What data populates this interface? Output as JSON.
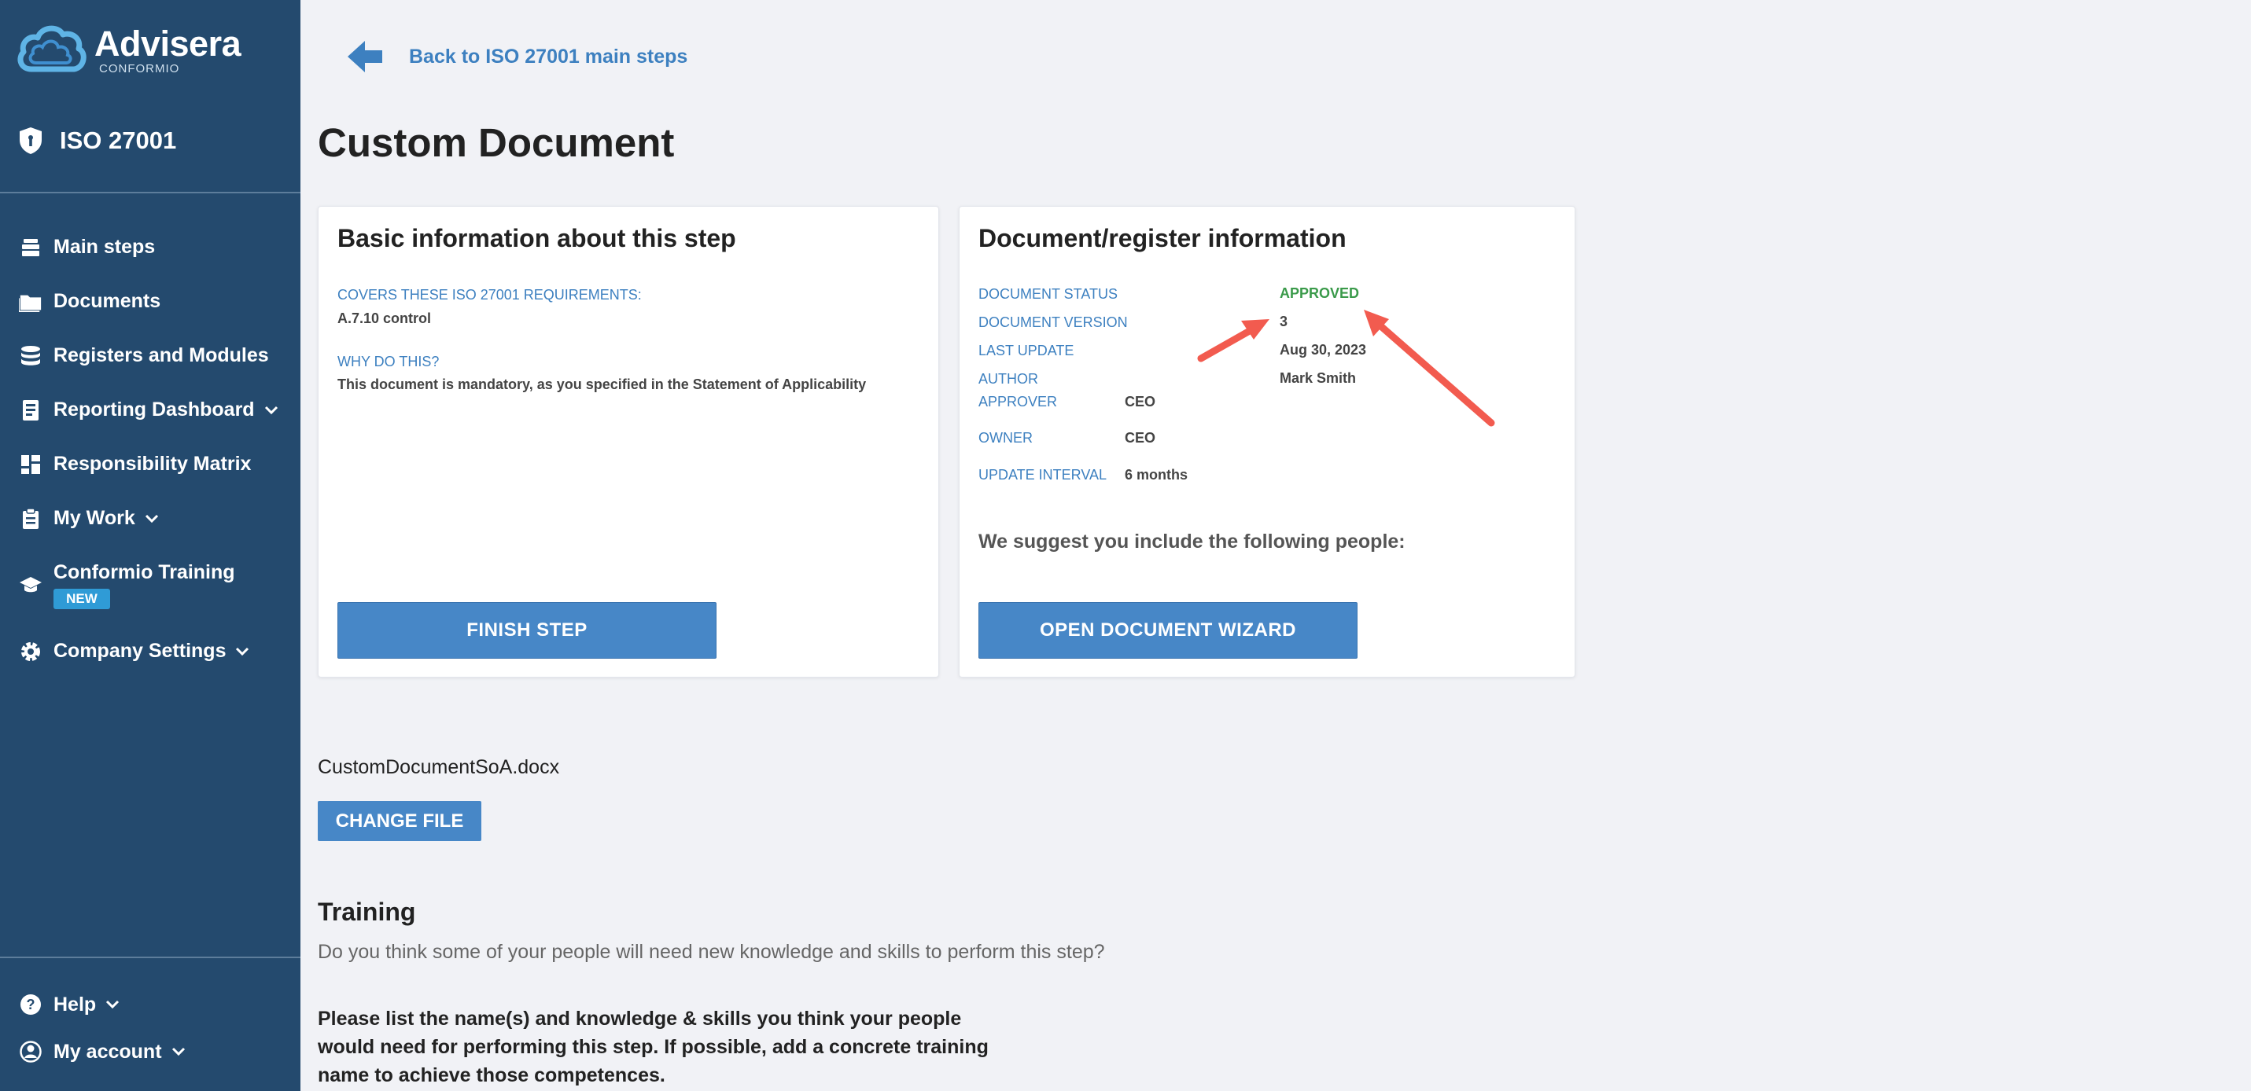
{
  "sidebar": {
    "logo": {
      "brand": "Advisera",
      "sub": "CONFORMIO"
    },
    "product": "ISO 27001",
    "items": [
      {
        "label": "Main steps",
        "icon": "layers-icon"
      },
      {
        "label": "Documents",
        "icon": "folder-icon"
      },
      {
        "label": "Registers and Modules",
        "icon": "database-icon"
      },
      {
        "label": "Reporting Dashboard",
        "icon": "report-icon"
      },
      {
        "label": "Responsibility Matrix",
        "icon": "grid-icon"
      },
      {
        "label": "My Work",
        "icon": "clipboard-icon"
      },
      {
        "label": "Conformio Training",
        "icon": "graduation-cap-icon",
        "badge": "NEW"
      },
      {
        "label": "Company Settings",
        "icon": "gear-icon"
      }
    ],
    "bottom": [
      {
        "label": "Help",
        "icon": "help-icon"
      },
      {
        "label": "My account",
        "icon": "account-icon"
      }
    ]
  },
  "main": {
    "back_link": "Back to ISO 27001 main steps",
    "title": "Custom Document",
    "basic_card": {
      "title": "Basic information about this step",
      "covers_label": "COVERS THESE ISO 27001 REQUIREMENTS:",
      "covers_value": "A.7.10 control",
      "why_label": "WHY DO THIS?",
      "why_value": "This document is mandatory, as you specified in the Statement of Applicability",
      "button": "FINISH STEP"
    },
    "doc_card": {
      "title": "Document/register information",
      "status_label": "DOCUMENT STATUS",
      "status_value": "APPROVED",
      "version_label": "DOCUMENT VERSION",
      "version_value": "3",
      "update_label": "LAST UPDATE",
      "update_value": "Aug 30, 2023",
      "author_label": "AUTHOR",
      "author_value": "Mark Smith",
      "approver_label": "APPROVER",
      "approver_value": "CEO",
      "owner_label": "OWNER",
      "owner_value": "CEO",
      "interval_label": "UPDATE INTERVAL",
      "interval_value": "6 months",
      "suggest": "We suggest you include the following people:",
      "button": "OPEN DOCUMENT WIZARD"
    },
    "file": {
      "name": "CustomDocumentSoA.docx",
      "button": "CHANGE FILE"
    },
    "training": {
      "title": "Training",
      "question": "Do you think some of your people will need new knowledge and skills to perform this step?",
      "instructions": "Please list the name(s) and knowledge & skills you think your people would need for performing this step. If possible, add a concrete training name to achieve those competences."
    }
  },
  "colors": {
    "sidebar_bg": "#244a6e",
    "accent": "#4787c7",
    "link": "#3d80c0",
    "approved": "#3a9a4a",
    "annotation_arrow": "#f25b4f"
  }
}
